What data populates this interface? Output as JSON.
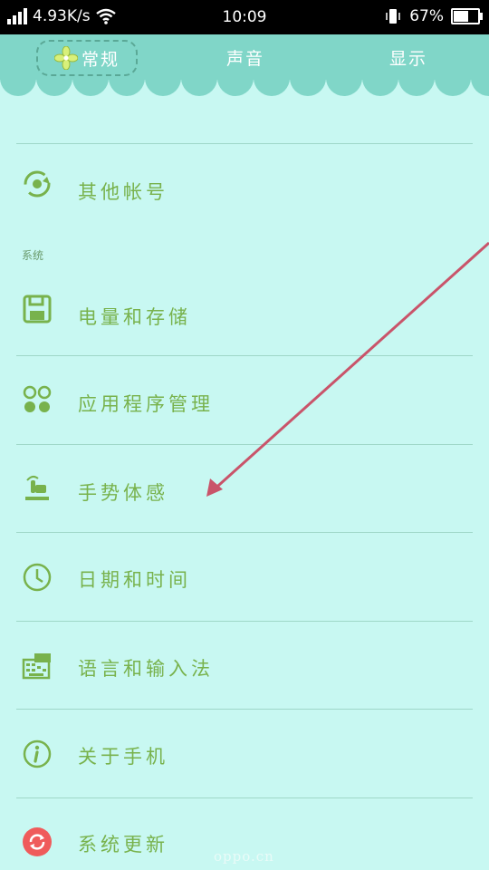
{
  "status_bar": {
    "speed": "4.93K/s",
    "time": "10:09",
    "battery": "67%",
    "battery_level": 0.67
  },
  "tabs": [
    {
      "label": "常规",
      "selected": true
    },
    {
      "label": "声音",
      "selected": false
    },
    {
      "label": "显示",
      "selected": false
    }
  ],
  "list": {
    "other_accounts": "其他帐号",
    "section_system": "系统",
    "power_storage": "电量和存储",
    "app_management": "应用程序管理",
    "gesture_motion": "手势体感",
    "date_time": "日期和时间",
    "language_input": "语言和输入法",
    "about_phone": "关于手机",
    "system_update": "系统更新"
  },
  "watermark": "oppo.cn",
  "colors": {
    "background": "#c8f8f2",
    "header": "#80d6c8",
    "label_green": "#78b24c",
    "arrow": "#c9546a",
    "update_red": "#ef5b5b"
  }
}
